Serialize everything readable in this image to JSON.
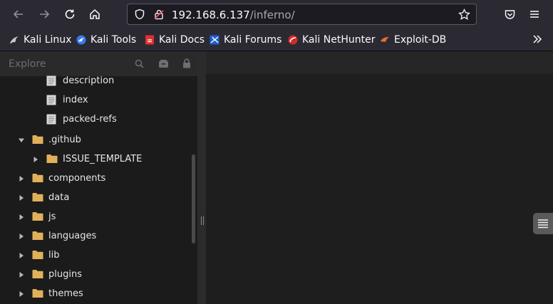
{
  "browser": {
    "url_host": "192.168.6.137",
    "url_path": "/inferno/"
  },
  "bookmarks": [
    {
      "label": "Kali Linux",
      "icon": "kali-dragon-icon"
    },
    {
      "label": "Kali Tools",
      "icon": "kali-tools-icon"
    },
    {
      "label": "Kali Docs",
      "icon": "kali-docs-icon"
    },
    {
      "label": "Kali Forums",
      "icon": "kali-forums-icon"
    },
    {
      "label": "Kali NetHunter",
      "icon": "kali-nethunter-icon"
    },
    {
      "label": "Exploit-DB",
      "icon": "exploit-db-icon"
    }
  ],
  "sidebar": {
    "title": "Explore",
    "items": [
      {
        "label": "description",
        "type": "file",
        "expanded": null
      },
      {
        "label": "index",
        "type": "file",
        "expanded": null
      },
      {
        "label": "packed-refs",
        "type": "file",
        "expanded": null
      },
      {
        "label": ".github",
        "type": "folder",
        "expanded": true
      },
      {
        "label": "ISSUE_TEMPLATE",
        "type": "folder",
        "expanded": false
      },
      {
        "label": "components",
        "type": "folder",
        "expanded": false
      },
      {
        "label": "data",
        "type": "folder",
        "expanded": false
      },
      {
        "label": "js",
        "type": "folder",
        "expanded": false
      },
      {
        "label": "languages",
        "type": "folder",
        "expanded": false
      },
      {
        "label": "lib",
        "type": "folder",
        "expanded": false
      },
      {
        "label": "plugins",
        "type": "folder",
        "expanded": false
      },
      {
        "label": "themes",
        "type": "folder",
        "expanded": false
      }
    ]
  },
  "colors": {
    "folder": "#e0b15a",
    "file": "#d8d8d8",
    "accent_kali": "#367bf0"
  }
}
